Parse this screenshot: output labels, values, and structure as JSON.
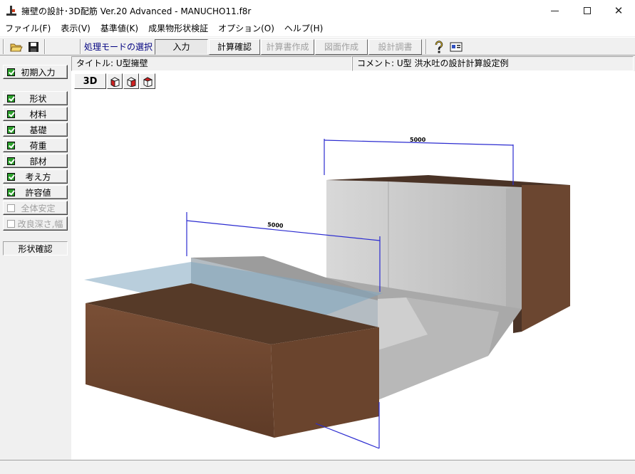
{
  "window": {
    "title": "擁壁の設計･3D配筋 Ver.20 Advanced  - MANUCHO11.f8r"
  },
  "menu": [
    "ファイル(F)",
    "表示(V)",
    "基準値(K)",
    "成果物形状検証",
    "オプション(O)",
    "ヘルプ(H)"
  ],
  "toolbar": {
    "mode_label": "処理モードの選択",
    "modes": [
      {
        "label": "入力",
        "state": "pressed"
      },
      {
        "label": "計算確認",
        "state": "normal"
      },
      {
        "label": "計算書作成",
        "state": "disabled"
      },
      {
        "label": "図面作成",
        "state": "disabled"
      },
      {
        "label": "設計調書",
        "state": "disabled"
      }
    ]
  },
  "info": {
    "title": "タイトル:  U型擁壁",
    "comment": "コメント:  U型 洪水吐の設計計算設定例"
  },
  "sidebar": {
    "items": [
      {
        "label": "初期入力",
        "checked": true,
        "enabled": true
      },
      {
        "label": "形状",
        "checked": true,
        "enabled": true
      },
      {
        "label": "材料",
        "checked": true,
        "enabled": true
      },
      {
        "label": "基礎",
        "checked": true,
        "enabled": true
      },
      {
        "label": "荷重",
        "checked": true,
        "enabled": true
      },
      {
        "label": "部材",
        "checked": true,
        "enabled": true
      },
      {
        "label": "考え方",
        "checked": true,
        "enabled": true
      },
      {
        "label": "許容値",
        "checked": true,
        "enabled": true
      },
      {
        "label": "全体安定",
        "checked": false,
        "enabled": false
      },
      {
        "label": "改良深さ,幅",
        "checked": false,
        "enabled": false
      }
    ],
    "shape_check": "形状確認"
  },
  "view": {
    "mode_label": "3D"
  },
  "dimensions": {
    "back_width": "5000",
    "front_width": "5000"
  },
  "colors": {
    "dim_line": "#2b2bd0",
    "soil": "#6b4630",
    "concrete": "#c8c8c8",
    "water": "#7fa6c0"
  }
}
